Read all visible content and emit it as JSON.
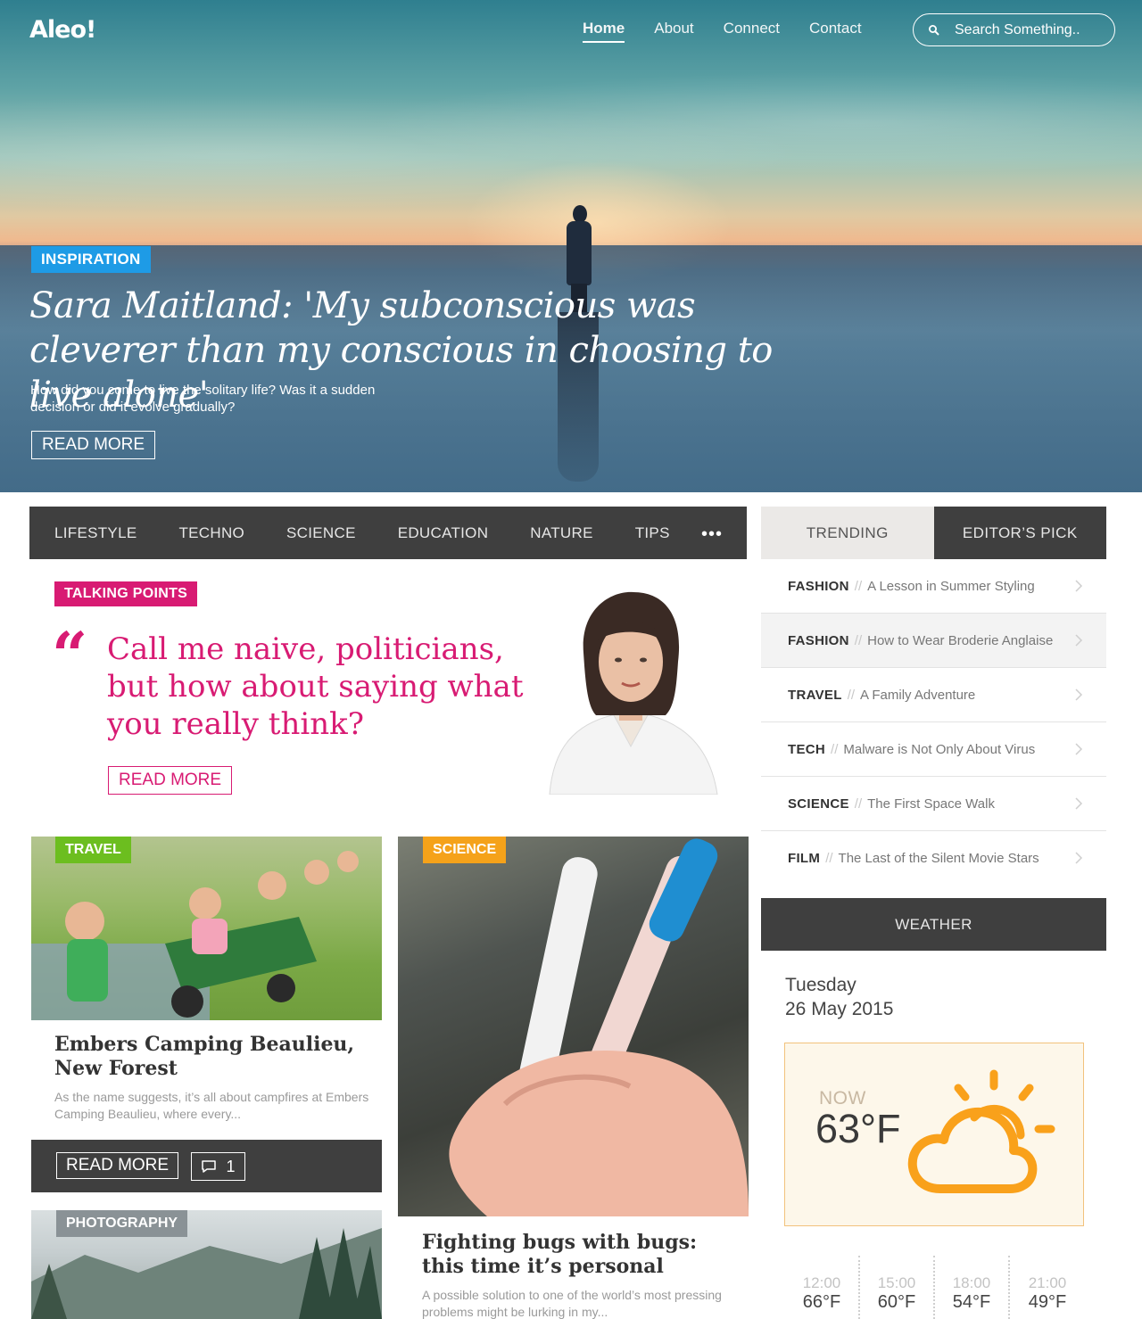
{
  "header": {
    "logo": "Aleo!",
    "nav": [
      "Home",
      "About",
      "Connect",
      "Contact"
    ],
    "active_nav": "Home",
    "search_placeholder": "Search Something.."
  },
  "hero": {
    "category": "INSPIRATION",
    "title": "Sara Maitland: 'My subconscious was cleverer than my conscious in choosing to live alone'",
    "description": "How did you come to live the solitary life? Was it a sudden decision or did it evolve gradually?",
    "read_more": "READ MORE"
  },
  "categories": [
    "LIFESTYLE",
    "TECHNO",
    "SCIENCE",
    "EDUCATION",
    "NATURE",
    "TIPS"
  ],
  "more_icon": "•••",
  "talking_points": {
    "badge": "TALKING POINTS",
    "quote": "Call me naive, politicians, but how about saying what you really think?",
    "read_more": "READ MORE"
  },
  "cards": {
    "travel": {
      "tag": "TRAVEL",
      "title": "Embers Camping Beaulieu, New Forest",
      "excerpt": "As the name suggests, it’s all about campfires at Embers Camping Beaulieu, where every...",
      "read_more": "READ MORE",
      "comments": "1"
    },
    "science": {
      "tag": "SCIENCE",
      "title": "Fighting bugs with bugs: this time it’s personal",
      "excerpt": "A possible solution to one of the world’s most pressing problems might be lurking in my..."
    },
    "photography": {
      "tag": "PHOTOGRAPHY"
    }
  },
  "sidebar": {
    "tabs": [
      "TRENDING",
      "EDITOR’S PICK"
    ],
    "trending": [
      {
        "cat": "FASHION",
        "title": "A Lesson in Summer Styling"
      },
      {
        "cat": "FASHION",
        "title": "How to Wear Broderie Anglaise"
      },
      {
        "cat": "TRAVEL",
        "title": "A Family Adventure"
      },
      {
        "cat": "TECH",
        "title": "Malware is Not Only About Virus"
      },
      {
        "cat": "SCIENCE",
        "title": "The First Space Walk"
      },
      {
        "cat": "FILM",
        "title": "The Last of the Silent Movie Stars"
      }
    ],
    "separator": "//"
  },
  "weather": {
    "heading": "WEATHER",
    "day": "Tuesday",
    "date": "26 May 2015",
    "now_label": "NOW",
    "now_temp": "63°F",
    "icon": "partly-cloudy-icon",
    "forecast": [
      {
        "time": "12:00",
        "temp": "66°F"
      },
      {
        "time": "15:00",
        "temp": "60°F"
      },
      {
        "time": "18:00",
        "temp": "54°F"
      },
      {
        "time": "21:00",
        "temp": "49°F"
      }
    ]
  },
  "colors": {
    "pink": "#d81b73",
    "blue": "#1e9be6",
    "green": "#6cbe1f",
    "orange": "#f5a21a",
    "dark": "#3f3f3f"
  }
}
